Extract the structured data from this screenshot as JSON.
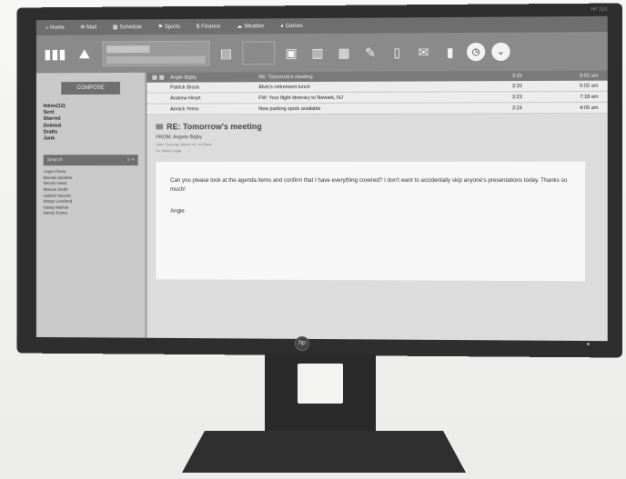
{
  "monitor": {
    "brand_logo": "hp",
    "corner_brand": "HP 2EE"
  },
  "nav": [
    {
      "icon": "home-icon",
      "glyph": "⌂",
      "label": "Home"
    },
    {
      "icon": "mail-icon",
      "glyph": "✉",
      "label": "Mail"
    },
    {
      "icon": "calendar-icon",
      "glyph": "▦",
      "label": "Schedule"
    },
    {
      "icon": "sports-icon",
      "glyph": "⚑",
      "label": "Sports"
    },
    {
      "icon": "finance-icon",
      "glyph": "$",
      "label": "Finance"
    },
    {
      "icon": "weather-icon",
      "glyph": "☁",
      "label": "Weather"
    },
    {
      "icon": "games-icon",
      "glyph": "♦",
      "label": "Games"
    }
  ],
  "sidebar": {
    "compose": "COMPOSE",
    "folders": [
      "Inbox(12)",
      "Sent",
      "Starred",
      "Deleted",
      "Drafts",
      "Junk"
    ],
    "search_label": "Search",
    "contacts": [
      "Angie Flores",
      "Brenda Sanders",
      "Dennis Heed",
      "Marcus Smith",
      "Gabriel Vincent",
      "Margo Loveland",
      "Kasey Marlow",
      "Danny Evans"
    ]
  },
  "table": {
    "header": {
      "from": "Angie Bigby",
      "subject": "RE: Tomorrow's meeting",
      "size": "3:25",
      "time": "8:52 am"
    },
    "rows": [
      {
        "from": "Patrick Brock",
        "subject": "Alvin's retirement lunch",
        "size": "3:20",
        "time": "6:02 am"
      },
      {
        "from": "Andrew Heart",
        "subject": "FW: Your flight itinerary to Newark, NJ",
        "size": "3:23",
        "time": "7:18 am"
      },
      {
        "from": "Annick Yemo",
        "subject": "New parking spots available",
        "size": "3:24",
        "time": "4:05 am"
      }
    ]
  },
  "reader": {
    "subject": "RE: Tomorrow's meeting",
    "from": "FROM: Angela Bigby",
    "date": "Date: Tuesday, March 10, 10:25am",
    "to": "To: Mariel Leigh",
    "body": "Can you please look at the agenda items and confirm that I have everything covered? I don't want to accidentally skip anyone's presentations today. Thanks so much!",
    "signature": "Angie"
  }
}
